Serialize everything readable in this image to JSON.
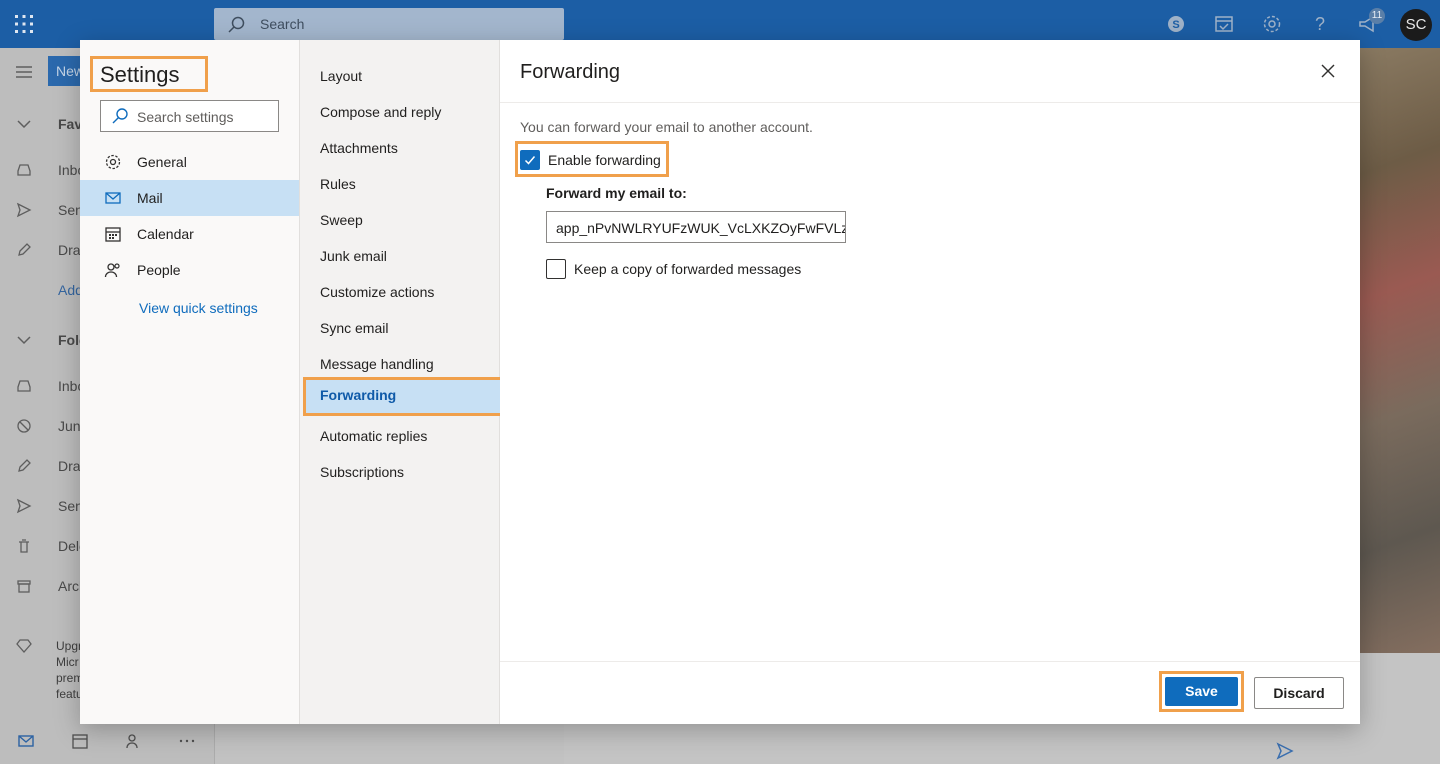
{
  "topbar": {
    "search_label": "Search",
    "notification_count": "11",
    "avatar_initials": "SC",
    "icons": [
      "app-launcher-icon",
      "skype-icon",
      "my-day-icon",
      "settings-icon",
      "help-icon",
      "feedback-icon"
    ]
  },
  "background": {
    "new_button_label": "New",
    "favorites_label": "Favo",
    "folders_label": "Fold",
    "nav_items": [
      "Inbo",
      "Sen",
      "Dra",
      "Add"
    ],
    "folder_items": [
      "Inbo",
      "Jun",
      "Dra",
      "Sen",
      "Dele",
      "Arch"
    ],
    "upgrade_text": "Upgr Micr prem featu"
  },
  "settings": {
    "title": "Settings",
    "search_placeholder": "Search settings",
    "categories": [
      {
        "label": "General",
        "icon": "gear-icon"
      },
      {
        "label": "Mail",
        "icon": "mail-icon"
      },
      {
        "label": "Calendar",
        "icon": "calendar-icon"
      },
      {
        "label": "People",
        "icon": "people-icon"
      }
    ],
    "selected_category": "Mail",
    "quick_settings_link": "View quick settings",
    "mail_subsections": [
      "Layout",
      "Compose and reply",
      "Attachments",
      "Rules",
      "Sweep",
      "Junk email",
      "Customize actions",
      "Sync email",
      "Message handling",
      "Forwarding",
      "Automatic replies",
      "Subscriptions"
    ],
    "selected_subsection": "Forwarding"
  },
  "forwarding": {
    "title": "Forwarding",
    "description": "You can forward your email to another account.",
    "enable_label": "Enable forwarding",
    "enable_checked": true,
    "forward_to_label": "Forward my email to:",
    "forward_to_value": "app_nPvNWLRYUFzWUK_VcLXKZOyFwFVLz...",
    "keep_copy_label": "Keep a copy of forwarded messages",
    "keep_copy_checked": false,
    "save_label": "Save",
    "discard_label": "Discard"
  },
  "colors": {
    "accent": "#0f6cbd",
    "highlight_outline": "#f0a04b",
    "topbar": "#1c5ea5",
    "selected_bg": "#c7e0f4"
  }
}
